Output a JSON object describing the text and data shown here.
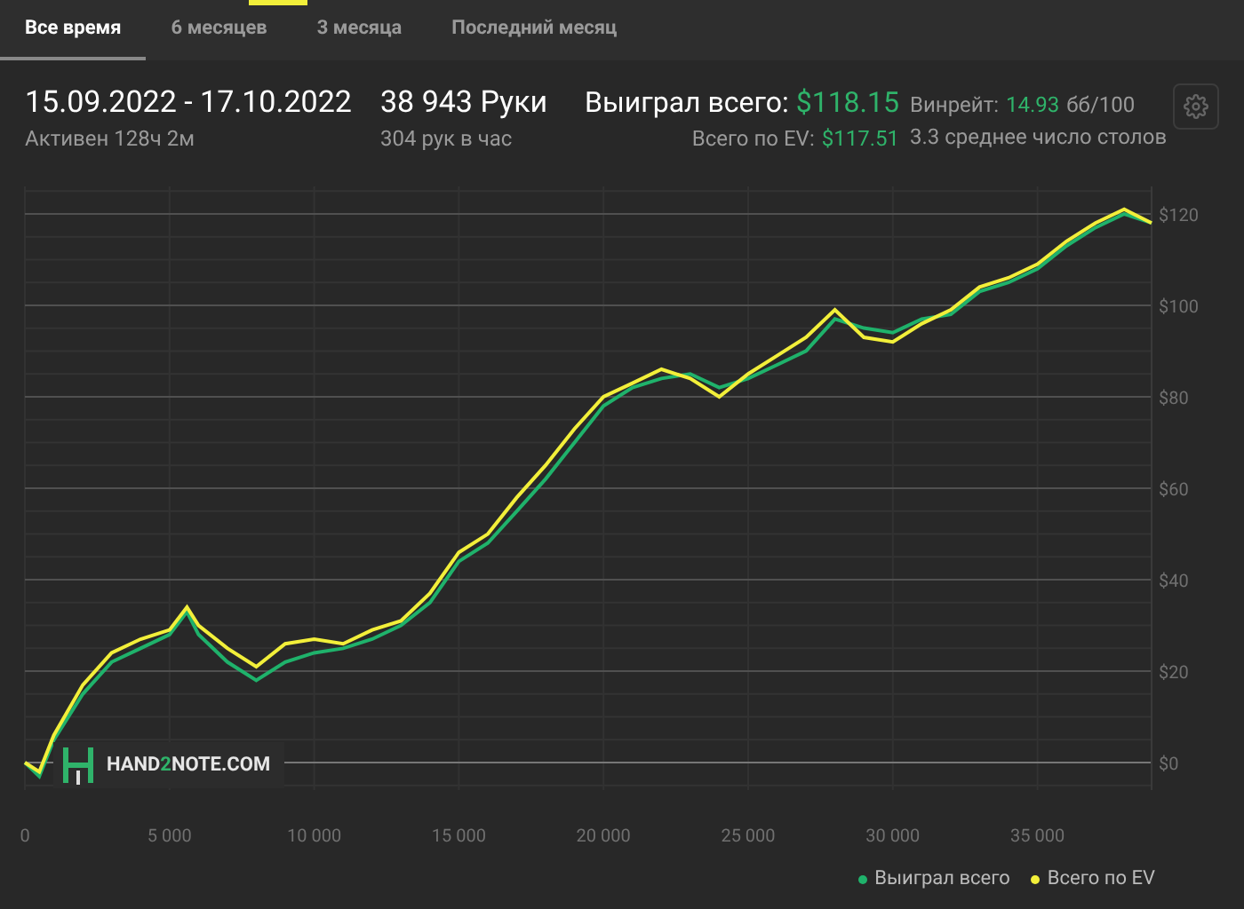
{
  "tabs": [
    {
      "label": "Все время",
      "selected": true
    },
    {
      "label": "6 месяцев",
      "selected": false
    },
    {
      "label": "3 месяца",
      "selected": false
    },
    {
      "label": "Последний месяц",
      "selected": false
    }
  ],
  "stats": {
    "date_range": "15.09.2022 - 17.10.2022",
    "active": "Активен 128ч 2м",
    "hands": "38 943 Руки",
    "hands_per_hour": "304 рук в час",
    "won_label": "Выиграл всего:",
    "won_value": "$118.15",
    "ev_label": "Всего по EV:",
    "ev_value": "$117.51",
    "winrate_label": "Винрейт:",
    "winrate_value": "14.93",
    "winrate_unit": "бб/100",
    "tables": "3.3 среднее число столов"
  },
  "logo": {
    "parts": [
      "HAND",
      "2",
      "NOTE.COM"
    ]
  },
  "chart_data": {
    "type": "line",
    "x": [
      0,
      500,
      1000,
      2000,
      3000,
      4000,
      5000,
      5600,
      6000,
      7000,
      8000,
      9000,
      10000,
      11000,
      12000,
      13000,
      14000,
      15000,
      16000,
      17000,
      18000,
      19000,
      20000,
      21000,
      22000,
      23000,
      24000,
      25000,
      26000,
      27000,
      28000,
      29000,
      30000,
      31000,
      32000,
      33000,
      34000,
      35000,
      36000,
      37000,
      38000,
      38943
    ],
    "series": [
      {
        "name": "Выиграл всего",
        "color": "#1fb26b",
        "values": [
          0,
          -3,
          5,
          15,
          22,
          25,
          28,
          33,
          28,
          22,
          18,
          22,
          24,
          25,
          27,
          30,
          35,
          44,
          48,
          55,
          62,
          70,
          78,
          82,
          84,
          85,
          82,
          84,
          87,
          90,
          97,
          95,
          94,
          97,
          98,
          103,
          105,
          108,
          113,
          117,
          120,
          118
        ]
      },
      {
        "name": "Всего по EV",
        "color": "#f2ef3a",
        "values": [
          0,
          -2,
          6,
          17,
          24,
          27,
          29,
          34,
          30,
          25,
          21,
          26,
          27,
          26,
          29,
          31,
          37,
          46,
          50,
          58,
          65,
          73,
          80,
          83,
          86,
          84,
          80,
          85,
          89,
          93,
          99,
          93,
          92,
          96,
          99,
          104,
          106,
          109,
          114,
          118,
          121,
          118
        ]
      }
    ],
    "xlim": [
      0,
      38943
    ],
    "ylim": [
      -6,
      126
    ],
    "grid": true,
    "xticks": [
      {
        "value": 0,
        "label": "0"
      },
      {
        "value": 5000,
        "label": "5 000"
      },
      {
        "value": 10000,
        "label": "10 000"
      },
      {
        "value": 15000,
        "label": "15 000"
      },
      {
        "value": 20000,
        "label": "20 000"
      },
      {
        "value": 25000,
        "label": "25 000"
      },
      {
        "value": 30000,
        "label": "30 000"
      },
      {
        "value": 35000,
        "label": "35 000"
      }
    ],
    "yticks": [
      {
        "value": 0,
        "label": "$0"
      },
      {
        "value": 20,
        "label": "$20"
      },
      {
        "value": 40,
        "label": "$40"
      },
      {
        "value": 60,
        "label": "$60"
      },
      {
        "value": 80,
        "label": "$80"
      },
      {
        "value": 100,
        "label": "$100"
      },
      {
        "value": 120,
        "label": "$120"
      }
    ]
  }
}
